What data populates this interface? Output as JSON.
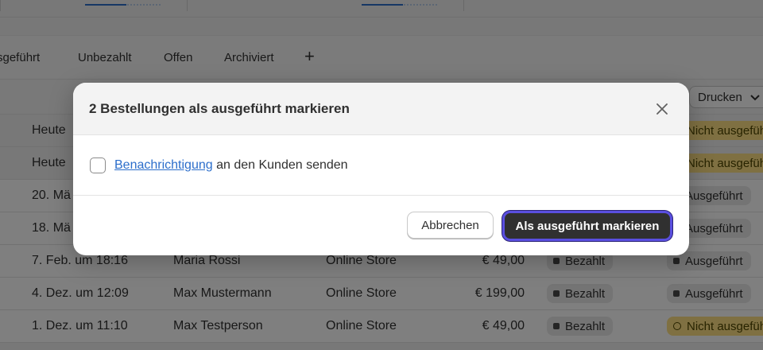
{
  "tabs": [
    "sgeführt",
    "Unbezahlt",
    "Offen",
    "Archiviert"
  ],
  "toolbar": {
    "add_symbol": "+",
    "print_label": "Drucken"
  },
  "orders": [
    {
      "date": "Heute",
      "customer": "",
      "channel": "",
      "total": "",
      "payment": "",
      "fulfillment": "Nicht ausgeführt",
      "fulfillment_status": "unfulfilled",
      "selected": true
    },
    {
      "date": "Heute",
      "customer": "",
      "channel": "",
      "total": "",
      "payment": "",
      "fulfillment": "Nicht ausgeführt",
      "fulfillment_status": "unfulfilled",
      "selected": true
    },
    {
      "date": "20. Mä",
      "customer": "",
      "channel": "",
      "total": "",
      "payment": "",
      "fulfillment": "Ausgeführt",
      "fulfillment_status": "fulfilled",
      "selected": false
    },
    {
      "date": "18. Mä",
      "customer": "",
      "channel": "",
      "total": "",
      "payment": "",
      "fulfillment": "Ausgeführt",
      "fulfillment_status": "fulfilled",
      "selected": false
    },
    {
      "date": "7. Feb. um 18:16",
      "customer": "Maria Rossi",
      "channel": "Online Store",
      "total": "€ 49,00",
      "payment": "Bezahlt",
      "fulfillment": "Ausgeführt",
      "fulfillment_status": "fulfilled",
      "selected": false
    },
    {
      "date": "4. Dez. um 12:09",
      "customer": "Max Mustermann",
      "channel": "Online Store",
      "total": "€ 199,00",
      "payment": "Bezahlt",
      "fulfillment": "Ausgeführt",
      "fulfillment_status": "fulfilled",
      "selected": false
    },
    {
      "date": "1. Dez. um 11:10",
      "customer": "Max Testperson",
      "channel": "Online Store",
      "total": "€ 49,00",
      "payment": "Bezahlt",
      "fulfillment": "Nicht ausgeführt",
      "fulfillment_status": "unfulfilled",
      "selected": false
    }
  ],
  "modal": {
    "title": "2 Bestellungen als ausgeführt markieren",
    "notify_link": "Benachrichtigung",
    "notify_text": " an den Kunden senden",
    "notify_checked": false,
    "cancel_label": "Abbrechen",
    "confirm_label": "Als ausgeführt markieren"
  },
  "colors": {
    "overlay": "rgba(0,0,0,0.5)",
    "primary_button": "#303030",
    "focus_ring": "#5a4fe0",
    "link": "#2c6ecb",
    "unfulfilled_badge": "#ffe184"
  },
  "icons": {
    "close": "close-icon",
    "unfulfilled": "incomplete-circle-icon",
    "status_dot": "status-dot-icon"
  }
}
